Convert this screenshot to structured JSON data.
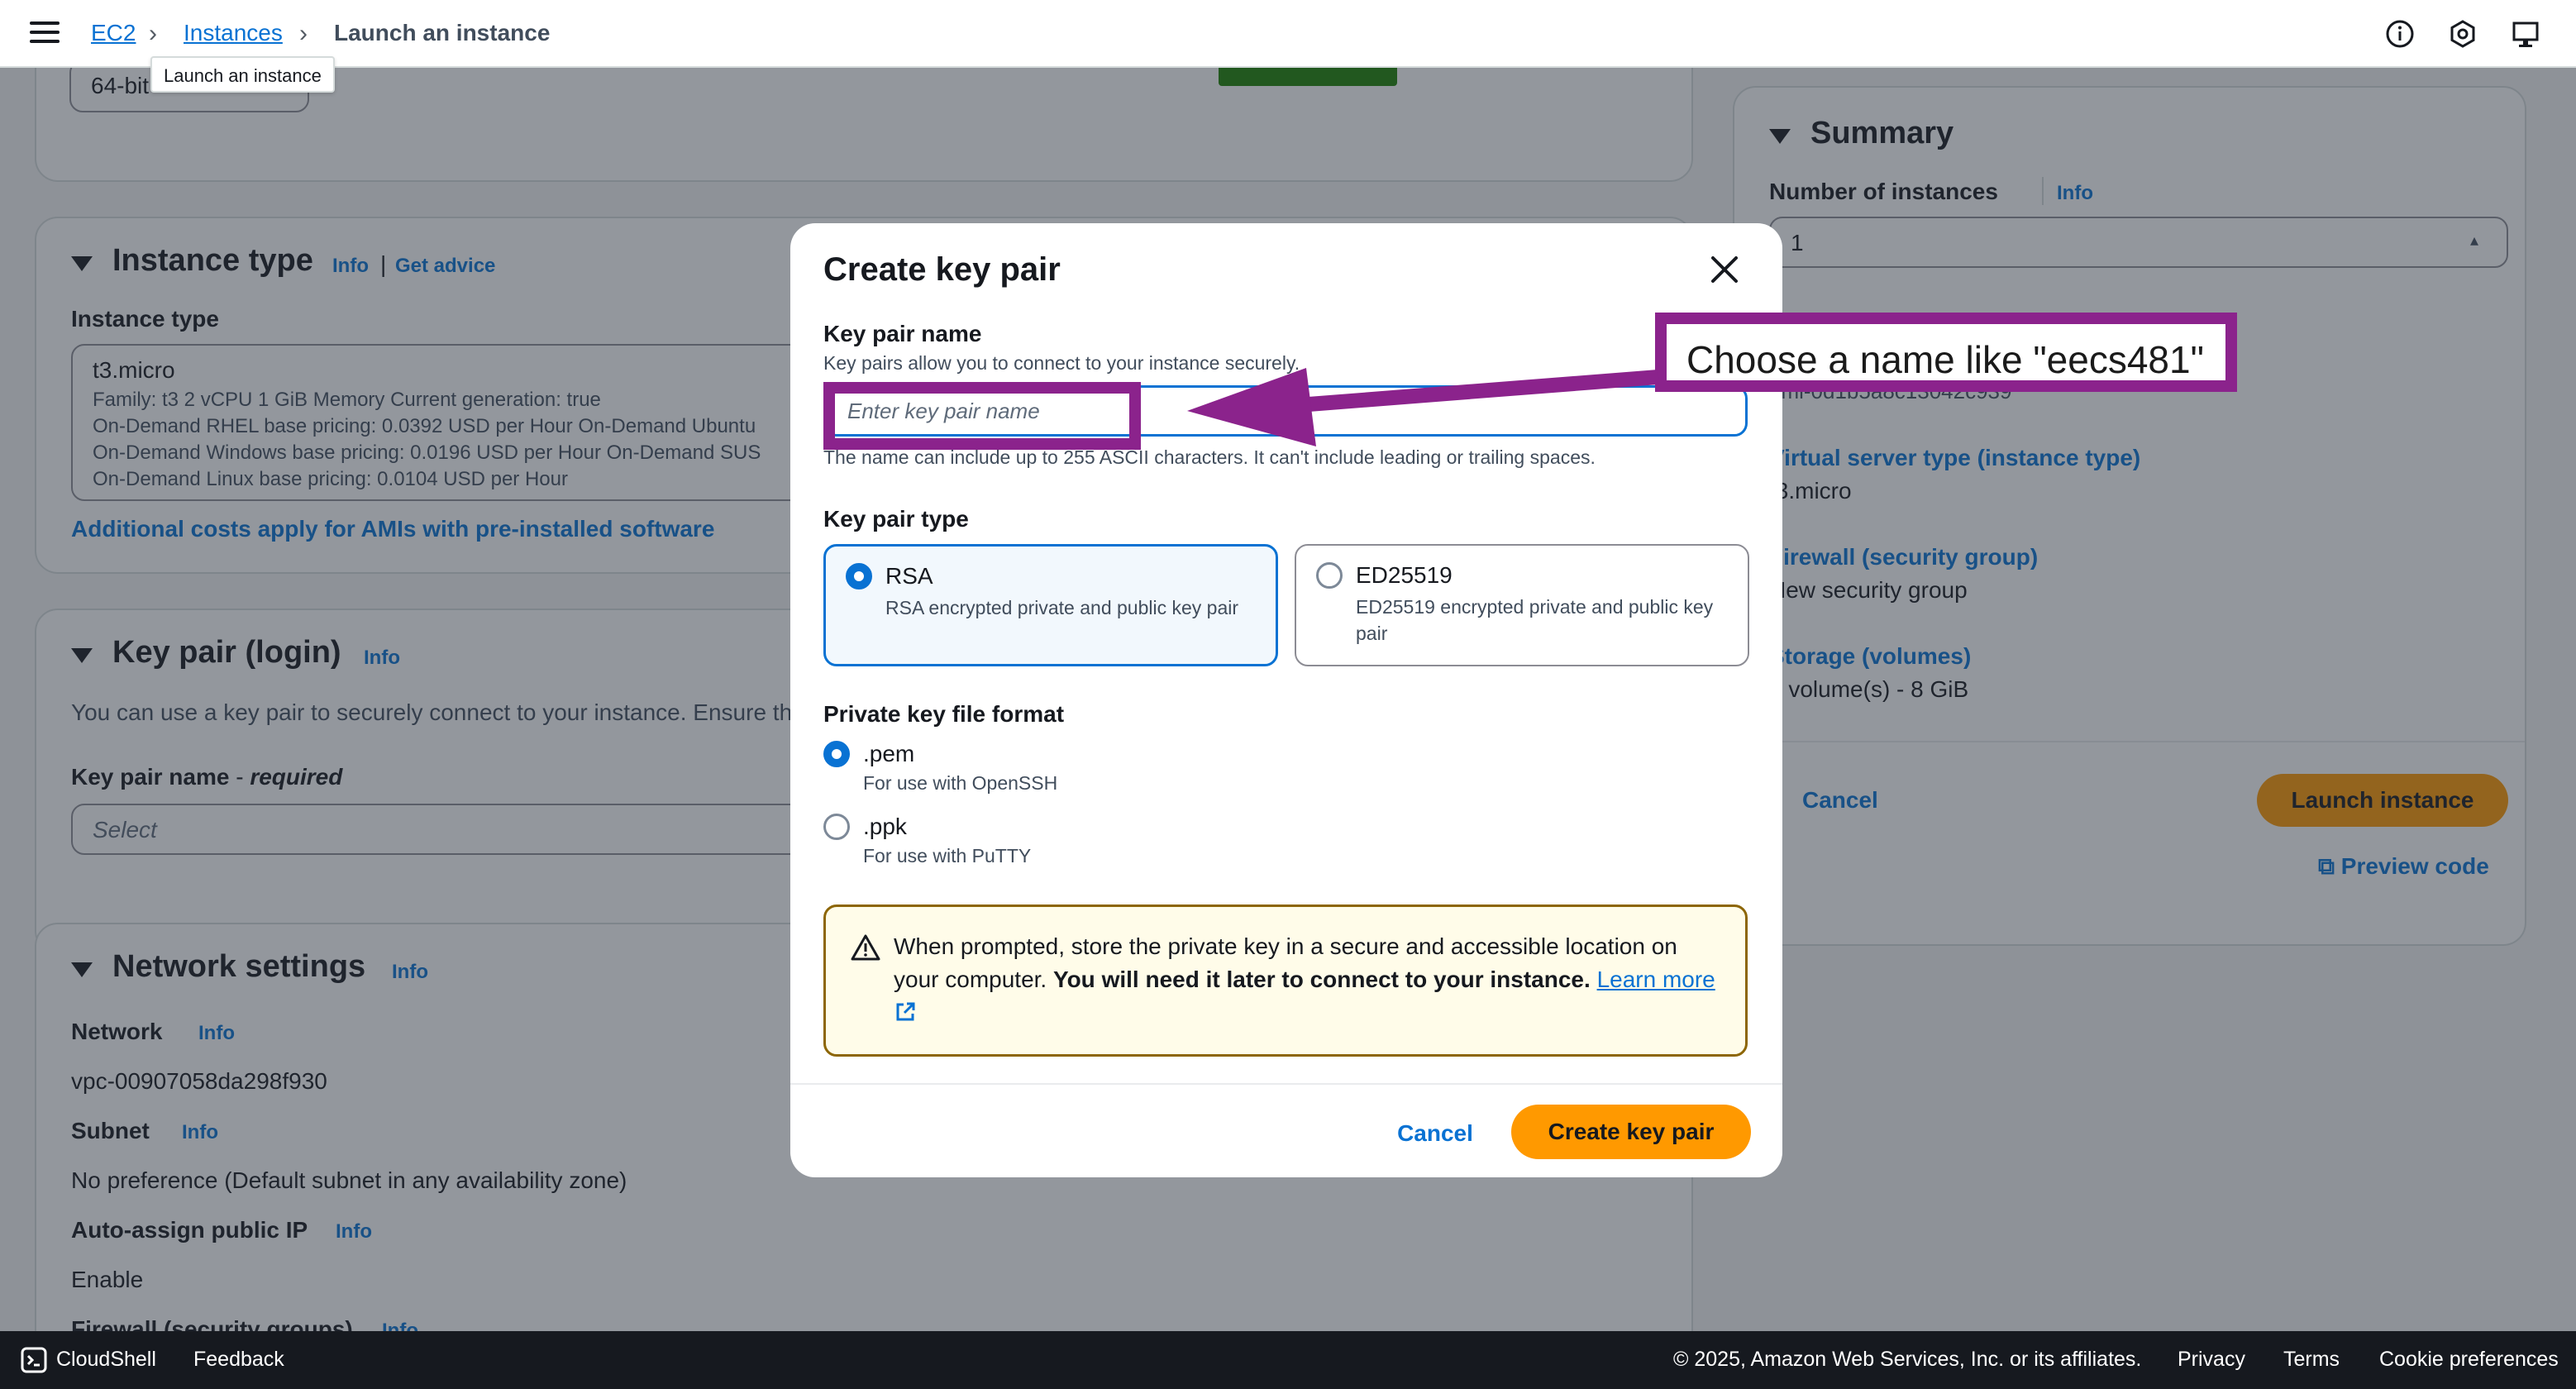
{
  "nav": {
    "breadcrumb_ec2": "EC2",
    "breadcrumb_instances": "Instances",
    "breadcrumb_current": "Launch an instance",
    "tooltip": "Launch an instance"
  },
  "top_card": {
    "arch_value": "64-bit"
  },
  "instance_type": {
    "title": "Instance type",
    "info": "Info",
    "separator": "|",
    "get_advice": "Get advice",
    "field_label": "Instance type",
    "selected": "t3.micro",
    "detail_1": "Family: t3     2 vCPU     1 GiB Memory     Current generation: true",
    "detail_2": "On-Demand RHEL base pricing: 0.0392 USD per Hour     On-Demand Ubuntu",
    "detail_3": "On-Demand Windows base pricing: 0.0196 USD per Hour     On-Demand SUS",
    "detail_4": "On-Demand Linux base pricing: 0.0104 USD per Hour",
    "costs_link": "Additional costs apply for AMIs with pre-installed software"
  },
  "key_pair_section": {
    "title": "Key pair (login)",
    "info": "Info",
    "description": "You can use a key pair to securely connect to your instance. Ensure th",
    "field_label": "Key pair name",
    "required": "required",
    "dash": " - ",
    "select_placeholder": "Select"
  },
  "network": {
    "title": "Network settings",
    "info": "Info",
    "network_label": "Network",
    "network_value": "vpc-00907058da298f930",
    "subnet_label": "Subnet",
    "subnet_value": "No preference (Default subnet in any availability zone)",
    "public_ip_label": "Auto-assign public IP",
    "public_ip_value": "Enable",
    "firewall_label": "Firewall (security groups)"
  },
  "summary": {
    "title": "Summary",
    "instances_label": "Number of instances",
    "info": "Info",
    "instances_value": "1",
    "ami_fragment": "ami-0d1b5a8c13042c939",
    "vst_label": "Virtual server type (instance type)",
    "vst_value": "t3.micro",
    "firewall_label": "Firewall (security group)",
    "firewall_value": "New security group",
    "storage_label": "Storage (volumes)",
    "storage_value": "1 volume(s) - 8 GiB",
    "cancel": "Cancel",
    "launch": "Launch instance",
    "preview": "Preview code"
  },
  "modal": {
    "title": "Create key pair",
    "name_label": "Key pair name",
    "name_desc": "Key pairs allow you to connect to your instance securely.",
    "name_placeholder": "Enter key pair name",
    "name_constraint": "The name can include up to 255 ASCII characters. It can't include leading or trailing spaces.",
    "type_label": "Key pair type",
    "rsa_title": "RSA",
    "rsa_desc": "RSA encrypted private and public key pair",
    "ed_title": "ED25519",
    "ed_desc": "ED25519 encrypted private and public key pair",
    "format_label": "Private key file format",
    "pem_title": ".pem",
    "pem_desc": "For use with OpenSSH",
    "ppk_title": ".ppk",
    "ppk_desc": "For use with PuTTY",
    "alert_text": "When prompted, store the private key in a secure and accessible location on your computer. ",
    "alert_bold": "You will need it later to connect to your instance.",
    "alert_link": "Learn more",
    "cancel": "Cancel",
    "create": "Create key pair"
  },
  "annotation": {
    "label": "Choose a name like \"eecs481\""
  },
  "footer": {
    "cloudshell": "CloudShell",
    "feedback": "Feedback",
    "copyright": "© 2025, Amazon Web Services, Inc. or its affiliates.",
    "privacy": "Privacy",
    "terms": "Terms",
    "cookies": "Cookie preferences"
  },
  "colors": {
    "accent": "#0972d3",
    "primary_button": "#ff9900",
    "annotation": "#8b238c",
    "warning_border": "#8d6605"
  }
}
